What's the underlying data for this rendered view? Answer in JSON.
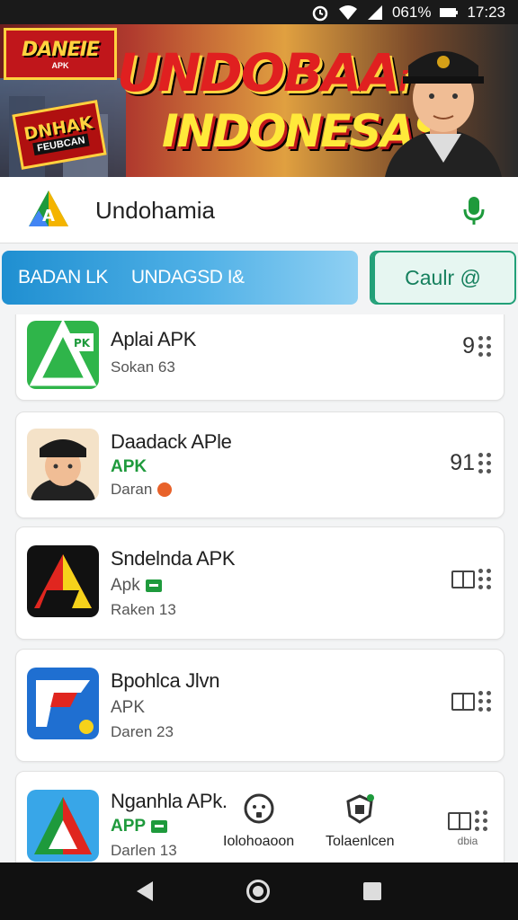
{
  "status_bar": {
    "battery": "061%",
    "time": "17:23"
  },
  "banner": {
    "logo_small_title": "DANEIE",
    "logo_small_sub": "APK",
    "badge_title": "DNHAK",
    "badge_sub": "FEUBCAN",
    "title_line1": "UNDOBAA",
    "title_suffix": "i",
    "title_line2": "INDONESAS"
  },
  "search": {
    "query": "Undohamia"
  },
  "filters": {
    "pill_a": "BADAN LK",
    "pill_b": "UNDAGSD I&",
    "button_label": "Caulr @"
  },
  "apps": [
    {
      "name": "Aplai APK",
      "sub": "Sokan 63",
      "rating": "9",
      "tag": ""
    },
    {
      "name": "Daadack APle",
      "tag": "APK",
      "sub": "Daran",
      "rating": "91"
    },
    {
      "name": "Sndelnda APK",
      "tag": "Apk",
      "sub": "Raken 13"
    },
    {
      "name": "Bpohlca Jlvn",
      "tag": "APK",
      "sub": "Daren 23"
    },
    {
      "name": "Nganhla APk.",
      "tag": "APP",
      "sub": "Darlen 13"
    }
  ],
  "bottom_tabs": [
    {
      "label": "Iolohoaoon"
    },
    {
      "label": "Tolaenlcen"
    },
    {
      "label": "dbia"
    }
  ],
  "colors": {
    "accent_green": "#1e9a3c",
    "pill_blue": "#1f8fd1",
    "banner_red": "#c0161b",
    "banner_yellow": "#ffe93a"
  }
}
